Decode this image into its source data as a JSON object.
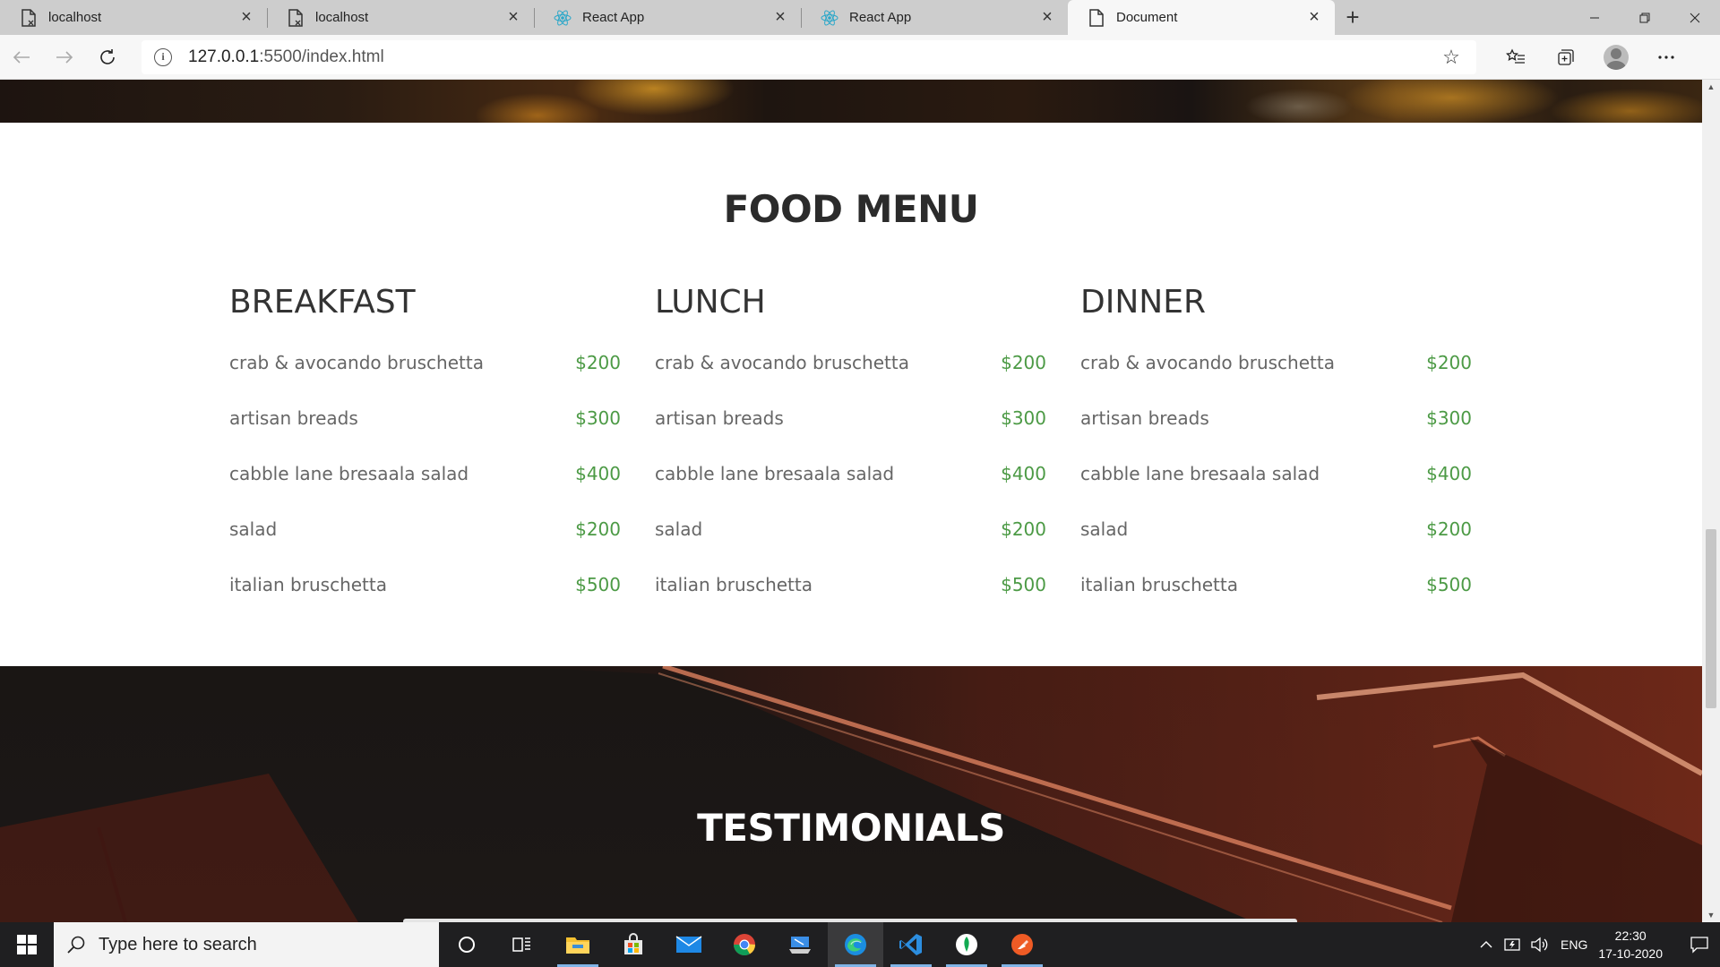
{
  "browser": {
    "tabs": [
      {
        "title": "localhost",
        "icon": "page-icon",
        "active": false
      },
      {
        "title": "localhost",
        "icon": "page-icon",
        "active": false
      },
      {
        "title": "React App",
        "icon": "react-icon",
        "active": false
      },
      {
        "title": "React App",
        "icon": "react-icon",
        "active": false
      },
      {
        "title": "Document",
        "icon": "page-icon",
        "active": true
      }
    ],
    "url_host": "127.0.0.1",
    "url_rest": ":5500/index.html"
  },
  "page": {
    "menu_heading": "FOOD MENU",
    "columns": [
      {
        "title": "BREAKFAST",
        "items": [
          {
            "name": "crab & avocando bruschetta",
            "price": "$200"
          },
          {
            "name": "artisan breads",
            "price": "$300"
          },
          {
            "name": "cabble lane bresaala salad",
            "price": "$400"
          },
          {
            "name": "salad",
            "price": "$200"
          },
          {
            "name": "italian bruschetta",
            "price": "$500"
          }
        ]
      },
      {
        "title": "LUNCH",
        "items": [
          {
            "name": "crab & avocando bruschetta",
            "price": "$200"
          },
          {
            "name": "artisan breads",
            "price": "$300"
          },
          {
            "name": "cabble lane bresaala salad",
            "price": "$400"
          },
          {
            "name": "salad",
            "price": "$200"
          },
          {
            "name": "italian bruschetta",
            "price": "$500"
          }
        ]
      },
      {
        "title": "DINNER",
        "items": [
          {
            "name": "crab & avocando bruschetta",
            "price": "$200"
          },
          {
            "name": "artisan breads",
            "price": "$300"
          },
          {
            "name": "cabble lane bresaala salad",
            "price": "$400"
          },
          {
            "name": "salad",
            "price": "$200"
          },
          {
            "name": "italian bruschetta",
            "price": "$500"
          }
        ]
      }
    ],
    "testimonials_heading": "TESTIMONIALS",
    "price_color": "#4c9a45"
  },
  "taskbar": {
    "search_placeholder": "Type here to search",
    "apps": [
      "cortana-icon",
      "task-view-icon",
      "file-explorer-icon",
      "store-icon",
      "mail-icon",
      "chrome-icon",
      "remote-desktop-icon",
      "edge-icon",
      "vscode-icon",
      "mongodb-compass-icon",
      "postman-icon"
    ],
    "language": "ENG",
    "time": "22:30",
    "date": "17-10-2020"
  }
}
